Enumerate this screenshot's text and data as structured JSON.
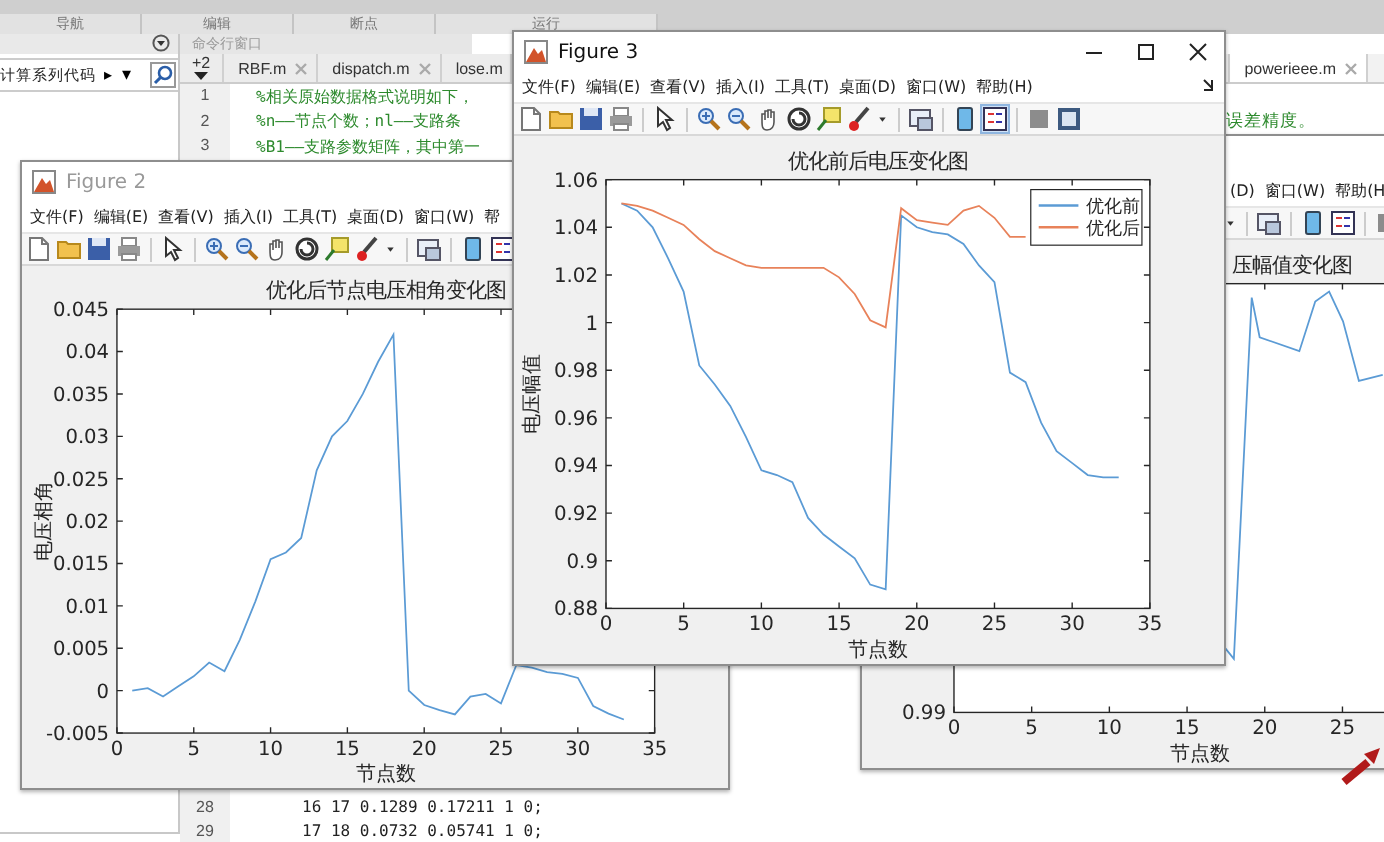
{
  "ribbon": {
    "sections": [
      "导航",
      "编辑",
      "断点",
      "运行"
    ]
  },
  "file_browser": {
    "path": "计算系列代码",
    "arrow": "▸",
    "dropdown": "▾"
  },
  "command_window": {
    "label": "命令行窗口"
  },
  "editor": {
    "tabs": [
      {
        "label": "+2",
        "kind": "overflow",
        "selected": false
      },
      {
        "label": "RBF.m",
        "kind": "file",
        "closable": true,
        "selected": false
      },
      {
        "label": "dispatch.m",
        "kind": "file",
        "closable": true,
        "selected": false
      },
      {
        "label": "lose.m",
        "kind": "file",
        "closable": false,
        "selected": false
      },
      {
        "label": "powerieee.m",
        "kind": "file",
        "closable": true,
        "selected": true
      }
    ],
    "lines": [
      {
        "number": "1",
        "code": "%相关原始数据格式说明如下，"
      },
      {
        "number": "2",
        "code": "%n——节点个数；nl——支路条",
        "tail": "误差精度。"
      },
      {
        "number": "3",
        "code": "%B1——支路参数矩阵，其中第一"
      }
    ],
    "bottom_lines": [
      {
        "number": "28",
        "code": "16 17 0.1289 0.17211 1 0;"
      },
      {
        "number": "29",
        "code": "17 18 0.0732 0.05741 1 0;"
      }
    ]
  },
  "figure_back": {
    "menu": [
      "(D)",
      "窗口(W)",
      "帮助(H"
    ],
    "plot": {
      "title": "压幅值变化图",
      "xticks": [
        "0",
        "5",
        "10",
        "15",
        "20",
        "25"
      ],
      "yticks": [
        "0.99"
      ],
      "xlabel": "节点数"
    }
  },
  "figure_2": {
    "title": "Figure 2",
    "menu": [
      "文件(F)",
      "编辑(E)",
      "查看(V)",
      "插入(I)",
      "工具(T)",
      "桌面(D)",
      "窗口(W)",
      "帮"
    ],
    "chart_data": {
      "type": "line",
      "title": "优化后节点电压相角变化图",
      "xlabel": "节点数",
      "ylabel": "电压相角",
      "x": [
        1,
        2,
        3,
        4,
        5,
        6,
        7,
        8,
        9,
        10,
        11,
        12,
        13,
        14,
        15,
        16,
        17,
        18,
        19,
        20,
        21,
        22,
        23,
        24,
        25,
        26,
        27,
        28,
        29,
        30,
        31,
        32,
        33
      ],
      "values": [
        0,
        0.0003,
        -0.0007,
        0.0005,
        0.0017,
        0.0033,
        0.0023,
        0.006,
        0.0105,
        0.0155,
        0.0163,
        0.018,
        0.026,
        0.03,
        0.0318,
        0.035,
        0.0388,
        0.042,
        0,
        -0.0017,
        -0.0023,
        -0.0028,
        -0.0007,
        -0.0004,
        -0.0015,
        0.003,
        0.0027,
        0.0022,
        0.002,
        0.0015,
        -0.0018,
        -0.0027,
        -0.0034
      ],
      "xlim": [
        0,
        35
      ],
      "ylim": [
        -0.005,
        0.045
      ],
      "xticks": [
        0,
        5,
        10,
        15,
        20,
        25,
        30,
        35
      ],
      "yticks": [
        -0.005,
        0,
        0.005,
        0.01,
        0.015,
        0.02,
        0.025,
        0.03,
        0.035,
        0.04,
        0.045
      ]
    }
  },
  "figure_3": {
    "title": "Figure 3",
    "menu": [
      "文件(F)",
      "编辑(E)",
      "查看(V)",
      "插入(I)",
      "工具(T)",
      "桌面(D)",
      "窗口(W)",
      "帮助(H)"
    ],
    "chart_data": {
      "type": "line",
      "title": "优化前后电压变化图",
      "xlabel": "节点数",
      "ylabel": "电压幅值",
      "x": [
        1,
        2,
        3,
        4,
        5,
        6,
        7,
        8,
        9,
        10,
        11,
        12,
        13,
        14,
        15,
        16,
        17,
        18,
        19,
        20,
        21,
        22,
        23,
        24,
        25,
        26,
        27,
        28,
        29,
        30,
        31,
        32,
        33
      ],
      "series": [
        {
          "name": "优化前",
          "color": "#5b9bd5",
          "values": [
            1.05,
            1.047,
            1.04,
            1.027,
            1.013,
            0.982,
            0.974,
            0.965,
            0.952,
            0.938,
            0.936,
            0.933,
            0.918,
            0.911,
            0.906,
            0.901,
            0.89,
            0.888,
            1.045,
            1.04,
            1.038,
            1.037,
            1.033,
            1.024,
            1.017,
            0.979,
            0.975,
            0.958,
            0.946,
            0.941,
            0.936,
            0.935,
            0.935
          ]
        },
        {
          "name": "优化后",
          "color": "#e8825a",
          "values": [
            1.05,
            1.049,
            1.047,
            1.044,
            1.041,
            1.035,
            1.03,
            1.027,
            1.024,
            1.023,
            1.023,
            1.023,
            1.023,
            1.023,
            1.019,
            1.012,
            1.001,
            0.998,
            1.048,
            1.043,
            1.042,
            1.041,
            1.047,
            1.049,
            1.044,
            1.036,
            1.036,
            null,
            null,
            null,
            null,
            null,
            null
          ]
        }
      ],
      "legend": "upper right",
      "xlim": [
        0,
        35
      ],
      "ylim": [
        0.88,
        1.06
      ],
      "xticks": [
        0,
        5,
        10,
        15,
        20,
        25,
        30,
        35
      ],
      "yticks": [
        0.88,
        0.9,
        0.92,
        0.94,
        0.96,
        0.98,
        1,
        1.02,
        1.04,
        1.06
      ]
    }
  }
}
